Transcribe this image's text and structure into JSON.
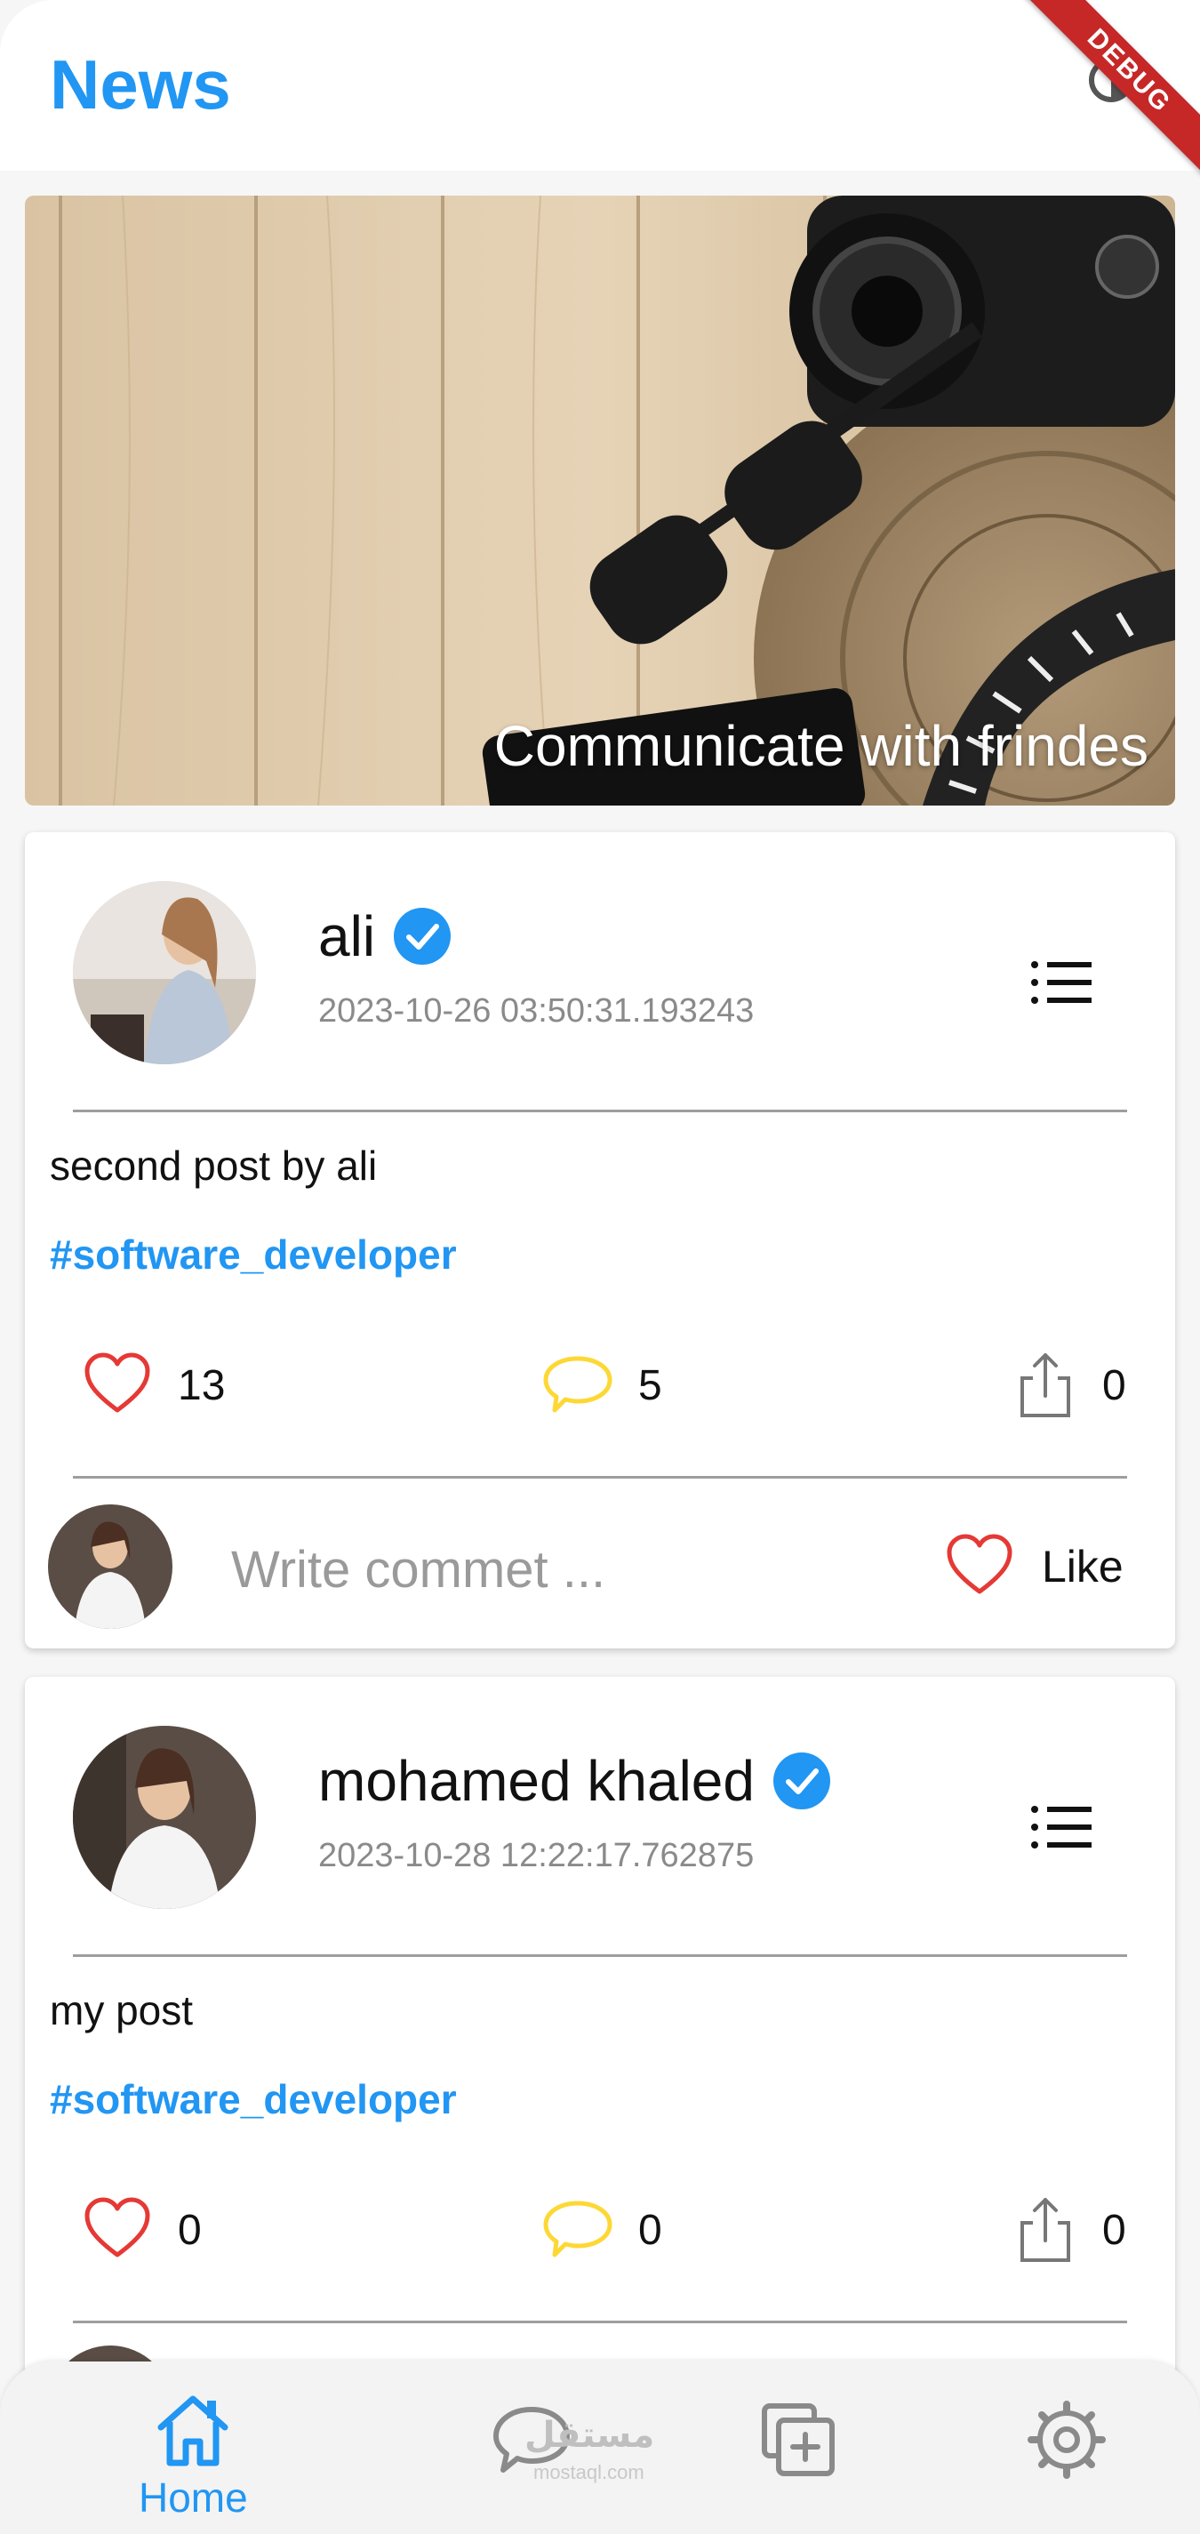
{
  "appbar": {
    "title": "News",
    "debug_label": "DEBUG"
  },
  "banner": {
    "caption": "Communicate with frindes"
  },
  "posts": [
    {
      "author": "ali",
      "date": "2023-10-26 03:50:31.193243",
      "text": "second post by ali",
      "tag": "#software_developer",
      "likes": "13",
      "comments": "5",
      "shares": "0",
      "comment_placeholder": "Write commet ...",
      "like_label": "Like"
    },
    {
      "author": "mohamed khaled",
      "date": "2023-10-28 12:22:17.762875",
      "text": "my post",
      "tag": "#software_developer",
      "likes": "0",
      "comments": "0",
      "shares": "0"
    }
  ],
  "bottom_nav": {
    "items": [
      {
        "icon": "home-icon",
        "label": "Home",
        "active": true
      },
      {
        "icon": "chat-icon",
        "label": ""
      },
      {
        "icon": "add-post-icon",
        "label": ""
      },
      {
        "icon": "settings-icon",
        "label": ""
      }
    ],
    "watermark": "مستقل",
    "watermark_sub": "mostaql.com"
  },
  "colors": {
    "accent": "#2196f3",
    "like": "#e53935",
    "comment": "#fdd835",
    "debug": "#c62828"
  }
}
